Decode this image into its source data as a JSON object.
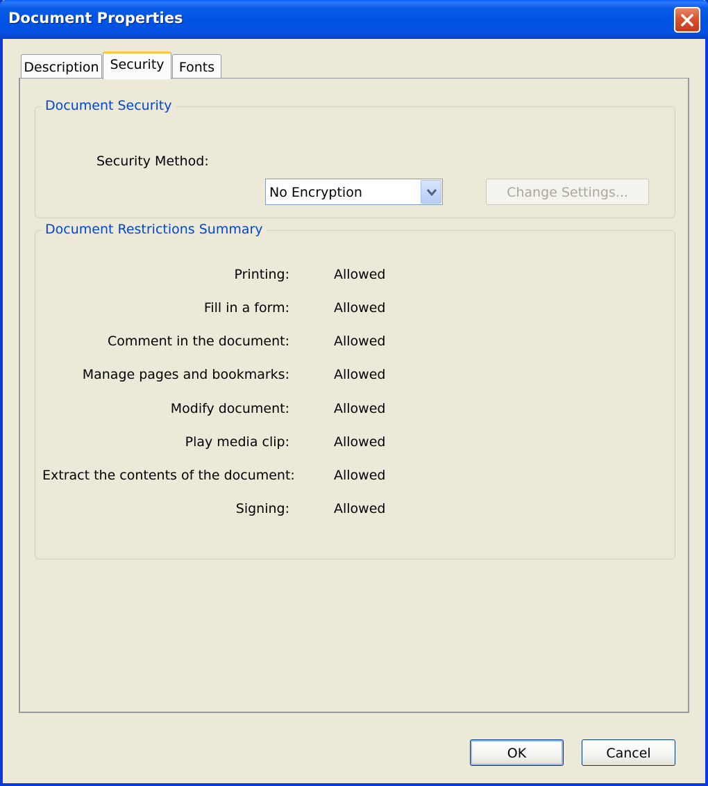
{
  "window": {
    "title": "Document Properties"
  },
  "tabs": [
    {
      "label": "Description",
      "active": false
    },
    {
      "label": "Security",
      "active": true
    },
    {
      "label": "Fonts",
      "active": false
    }
  ],
  "document_security": {
    "legend": "Document Security",
    "security_method_label": "Security Method:",
    "security_method_value": "No Encryption",
    "change_settings_label": "Change Settings..."
  },
  "restrictions": {
    "legend": "Document Restrictions Summary",
    "rows": [
      {
        "label": "Printing:",
        "value": "Allowed"
      },
      {
        "label": "Fill in a form:",
        "value": "Allowed"
      },
      {
        "label": "Comment in the document:",
        "value": "Allowed"
      },
      {
        "label": "Manage pages and bookmarks:",
        "value": "Allowed"
      },
      {
        "label": "Modify document:",
        "value": "Allowed"
      },
      {
        "label": "Play media clip:",
        "value": "Allowed"
      },
      {
        "label": "Extract the contents of the document:",
        "value": "Allowed"
      },
      {
        "label": "Signing:",
        "value": "Allowed"
      }
    ]
  },
  "footer": {
    "ok_label": "OK",
    "cancel_label": "Cancel"
  },
  "icons": {
    "close": "close-icon",
    "dropdown": "chevron-down-icon"
  },
  "colors": {
    "title_bar": "#0054e3",
    "legend_text": "#0046d5",
    "tab_active_accent": "#ffc83c",
    "close_button": "#d9532d"
  }
}
